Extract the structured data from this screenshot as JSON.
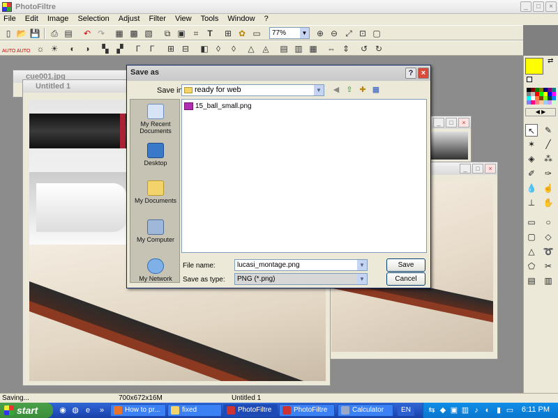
{
  "app": {
    "title": "PhotoFiltre",
    "window_controls": [
      "_",
      "□",
      "×"
    ]
  },
  "menu": [
    "File",
    "Edit",
    "Image",
    "Selection",
    "Adjust",
    "Filter",
    "View",
    "Tools",
    "Window",
    "?"
  ],
  "toolbar": {
    "zoom": "77%",
    "icons_row1": [
      "new-icon",
      "open-icon",
      "save-icon",
      "print-icon",
      "scan-icon",
      "undo-icon",
      "redo-icon",
      "color-icon",
      "grayscale-icon",
      "transparent-icon",
      "copy-icon",
      "paste-icon",
      "crop-icon",
      "text-icon",
      "tree-icon",
      "plugin-icon",
      "browser-icon",
      "zoom-in-icon",
      "zoom-out-icon",
      "fit-icon",
      "actual-size-icon",
      "fullscreen-icon"
    ],
    "auto_label": "AUTO"
  },
  "documents": [
    {
      "title": "cue001.jpg"
    },
    {
      "title": "Untitled 1"
    },
    {
      "title": ""
    },
    {
      "title": ""
    }
  ],
  "dialog": {
    "title": "Save as",
    "help_btn": "?",
    "close_btn": "×",
    "save_in_label": "Save in:",
    "save_in_value": "ready for web",
    "places": [
      "My Recent Documents",
      "Desktop",
      "My Documents",
      "My Computer",
      "My Network"
    ],
    "files": [
      "15_ball_small.png"
    ],
    "file_name_label": "File name:",
    "file_name_value": "lucasi_montage.png",
    "save_as_type_label": "Save as type:",
    "save_as_type_value": "PNG (*.png)",
    "save_button": "Save",
    "cancel_button": "Cancel"
  },
  "status": {
    "left": "Saving...",
    "size": "700x672x16M",
    "doc": "Untitled 1"
  },
  "taskbar": {
    "start": "start",
    "tasks": [
      {
        "label": "How to pr...",
        "color": "#e8742c"
      },
      {
        "label": "fixed",
        "color": "#f2d46a"
      },
      {
        "label": "PhotoFiltre",
        "color": "#cc3333"
      },
      {
        "label": "PhotoFiltre",
        "color": "#cc3333"
      },
      {
        "label": "Calculator",
        "color": "#9aa9c9"
      }
    ],
    "language": "EN",
    "clock": "6:11 PM"
  },
  "colors": {
    "foreground": "#ffff00",
    "background": "#000000",
    "xp_blue": "#2450bf",
    "dialog_border": "#0a246a"
  }
}
